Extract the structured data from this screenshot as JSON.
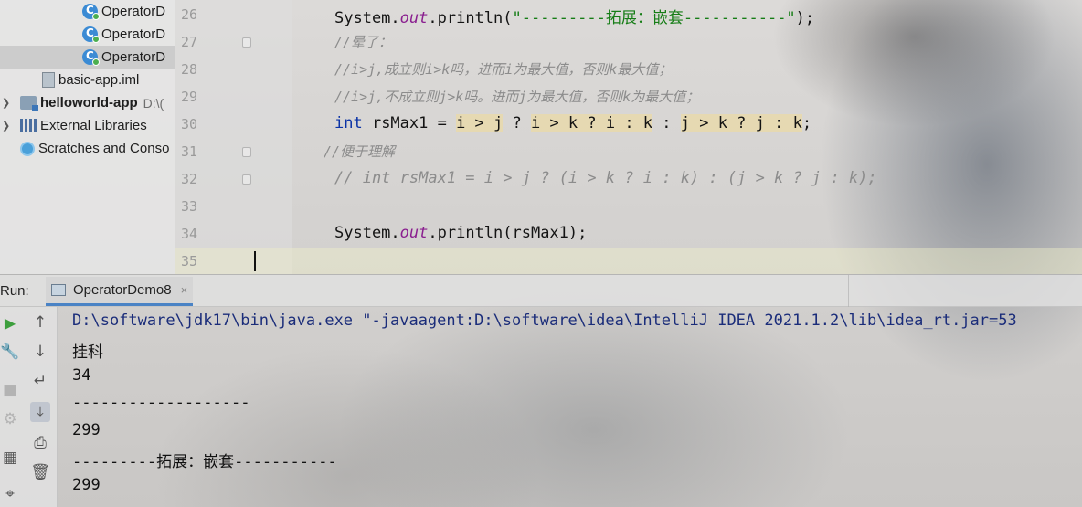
{
  "project_tree": {
    "items": [
      {
        "label": "OperatorD",
        "icon": "java-class-icon"
      },
      {
        "label": "OperatorD",
        "icon": "java-class-icon"
      },
      {
        "label": "OperatorD",
        "icon": "java-class-icon",
        "selected": true
      },
      {
        "label": "basic-app.iml",
        "icon": "iml-file-icon"
      },
      {
        "label": "helloworld-app",
        "hint": "D:\\(",
        "icon": "module-folder-icon"
      },
      {
        "label": "External Libraries",
        "icon": "library-icon"
      },
      {
        "label": "Scratches and Conso",
        "icon": "scratches-icon"
      }
    ]
  },
  "editor": {
    "line_numbers": [
      "26",
      "27",
      "28",
      "29",
      "30",
      "31",
      "32",
      "33",
      "34",
      "35"
    ],
    "lines": {
      "l26": {
        "a": "System.",
        "b": "out",
        "c": ".println(",
        "d": "\"---------拓展：嵌套-----------\"",
        "e": ");"
      },
      "l27": "//晕了：",
      "l28": "//i>j,成立则i>k吗，进而i为最大值，否则k最大值；",
      "l29": "//i>j,不成立则j>k吗。进而j为最大值，否则k为最大值；",
      "l30": {
        "kw": "int",
        "decl": " rsMax1 = ",
        "p1": "i > j",
        "p2": " ? ",
        "p3": "i > k ? i : k",
        "p4": " : ",
        "p5": "j > k ? j : k",
        "p6": ";"
      },
      "l31": "//便于理解",
      "l32": "// int rsMax1 = i > j ? (i > k ? i : k) : (j > k ? j : k);",
      "l34": {
        "a": "System.",
        "b": "out",
        "c": ".println(rsMax1);"
      }
    }
  },
  "run": {
    "label": "Run:",
    "tab": "OperatorDemo8",
    "close": "×",
    "output": [
      "D:\\software\\jdk17\\bin\\java.exe \"-javaagent:D:\\software\\idea\\IntelliJ IDEA 2021.1.2\\lib\\idea_rt.jar=53",
      "挂科",
      "34",
      "-------------------",
      "299",
      "---------拓展：嵌套-----------",
      "299"
    ]
  },
  "toolbar_icons": [
    "rerun-icon",
    "up-arrow-icon",
    "settings-wrench-icon",
    "down-arrow-icon",
    "stop-icon",
    "soft-wrap-icon",
    "settings-icon",
    "scroll-to-end-icon",
    "layout-icon",
    "print-icon",
    "pin-icon",
    "trash-icon"
  ],
  "colors": {
    "keyword": "#0b33a6",
    "field": "#8a1f8f",
    "string": "#167d16",
    "comment": "#8c8c8c",
    "highlight": "#f2dd96",
    "run_green": "#3c9e3c",
    "tab_underline": "#4a83c5"
  }
}
